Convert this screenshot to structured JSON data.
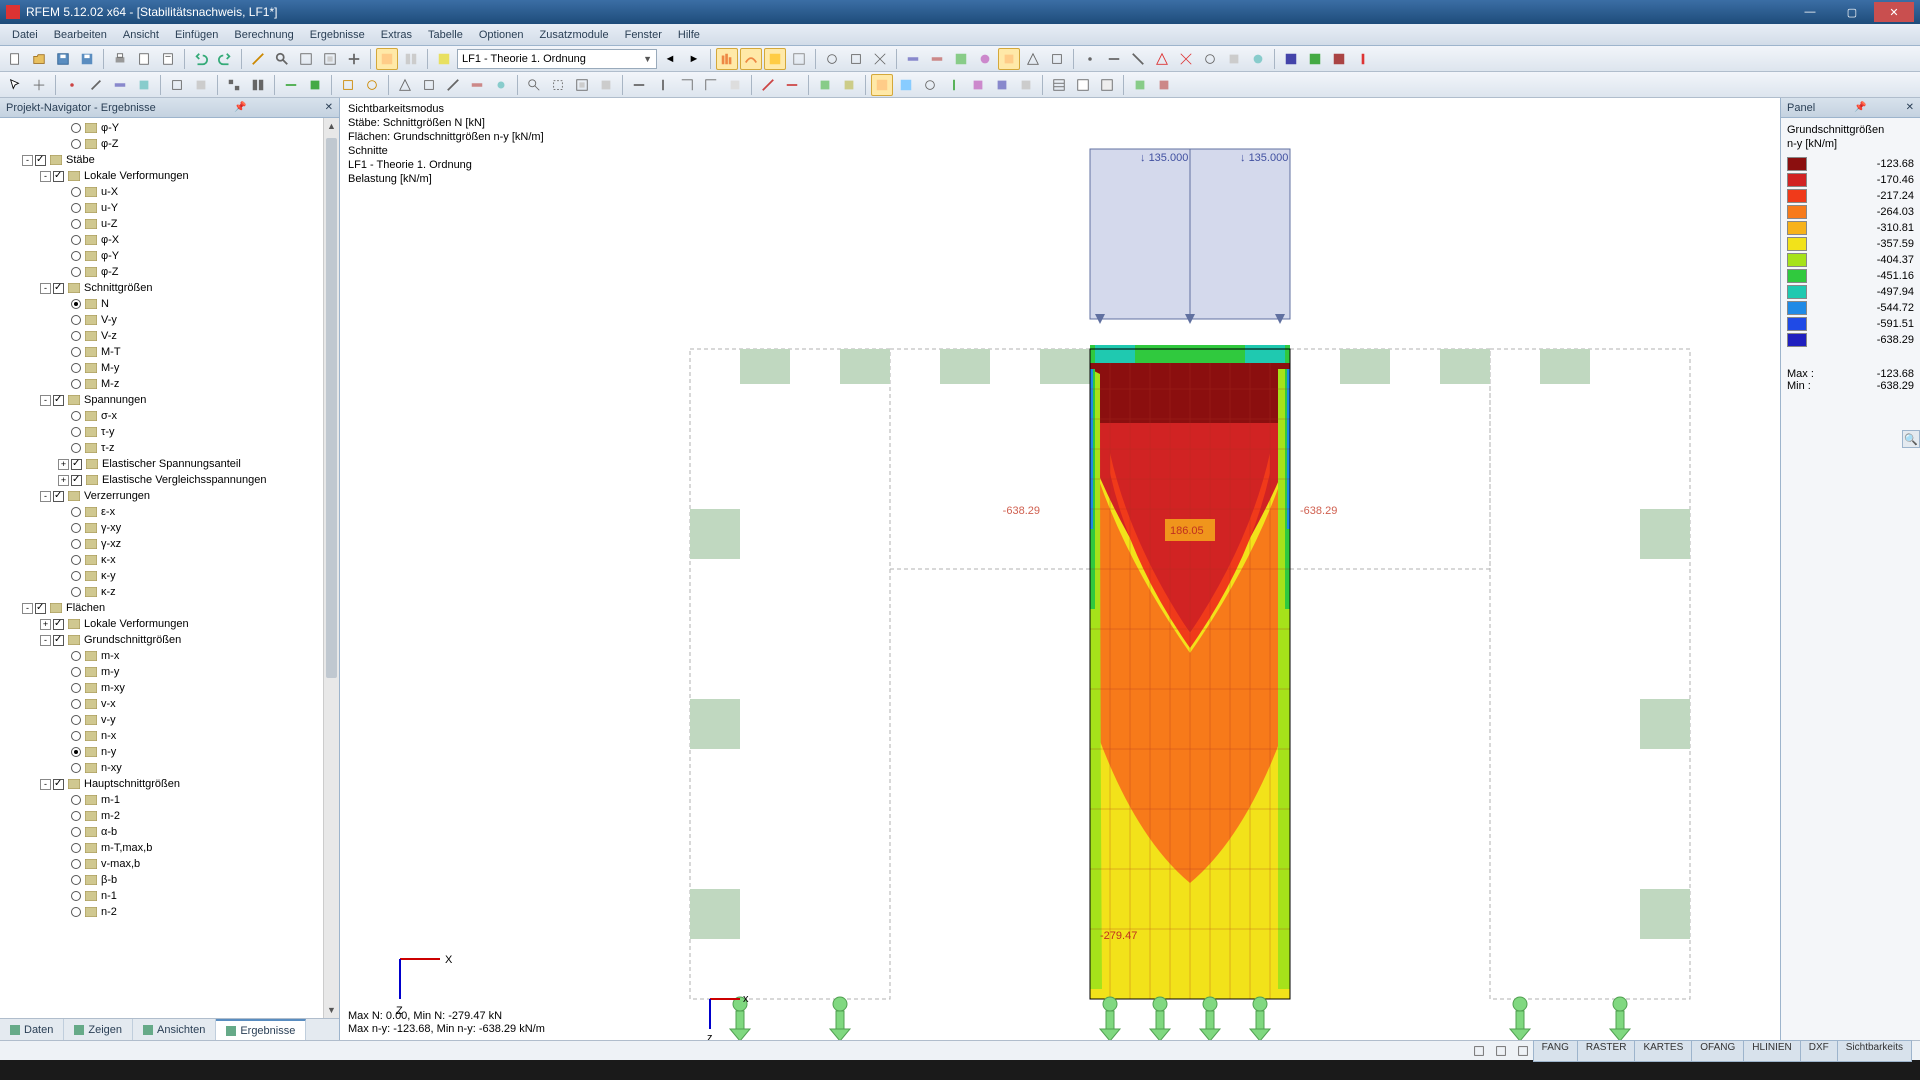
{
  "titlebar": {
    "text": "RFEM 5.12.02 x64 - [Stabilitätsnachweis, LF1*]"
  },
  "menu": [
    "Datei",
    "Bearbeiten",
    "Ansicht",
    "Einfügen",
    "Berechnung",
    "Ergebnisse",
    "Extras",
    "Tabelle",
    "Optionen",
    "Zusatzmodule",
    "Fenster",
    "Hilfe"
  ],
  "combo_lf": "LF1 - Theorie 1. Ordnung",
  "navigator": {
    "title": "Projekt-Navigator - Ergebnisse",
    "tabs": [
      "Daten",
      "Zeigen",
      "Ansichten",
      "Ergebnisse"
    ],
    "active_tab": 3,
    "tree": [
      {
        "d": 3,
        "type": "radio",
        "label": "φ-Y"
      },
      {
        "d": 3,
        "type": "radio",
        "label": "φ-Z"
      },
      {
        "d": 1,
        "type": "check",
        "checked": true,
        "label": "Stäbe",
        "exp": "-"
      },
      {
        "d": 2,
        "type": "check",
        "checked": true,
        "label": "Lokale Verformungen",
        "exp": "-"
      },
      {
        "d": 3,
        "type": "radio",
        "label": "u-X"
      },
      {
        "d": 3,
        "type": "radio",
        "label": "u-Y"
      },
      {
        "d": 3,
        "type": "radio",
        "label": "u-Z"
      },
      {
        "d": 3,
        "type": "radio",
        "label": "φ-X"
      },
      {
        "d": 3,
        "type": "radio",
        "label": "φ-Y"
      },
      {
        "d": 3,
        "type": "radio",
        "label": "φ-Z"
      },
      {
        "d": 2,
        "type": "check",
        "checked": true,
        "label": "Schnittgrößen",
        "exp": "-"
      },
      {
        "d": 3,
        "type": "radio",
        "sel": true,
        "label": "N"
      },
      {
        "d": 3,
        "type": "radio",
        "label": "V-y"
      },
      {
        "d": 3,
        "type": "radio",
        "label": "V-z"
      },
      {
        "d": 3,
        "type": "radio",
        "label": "M-T"
      },
      {
        "d": 3,
        "type": "radio",
        "label": "M-y"
      },
      {
        "d": 3,
        "type": "radio",
        "label": "M-z"
      },
      {
        "d": 2,
        "type": "check",
        "checked": true,
        "label": "Spannungen",
        "exp": "-"
      },
      {
        "d": 3,
        "type": "radio",
        "label": "σ-x"
      },
      {
        "d": 3,
        "type": "radio",
        "label": "τ-y"
      },
      {
        "d": 3,
        "type": "radio",
        "label": "τ-z"
      },
      {
        "d": 3,
        "type": "check",
        "checked": true,
        "label": "Elastischer Spannungsanteil",
        "exp": "+"
      },
      {
        "d": 3,
        "type": "check",
        "checked": true,
        "label": "Elastische Vergleichsspannungen",
        "exp": "+"
      },
      {
        "d": 2,
        "type": "check",
        "checked": true,
        "label": "Verzerrungen",
        "exp": "-"
      },
      {
        "d": 3,
        "type": "radio",
        "label": "ε-x"
      },
      {
        "d": 3,
        "type": "radio",
        "label": "γ-xy"
      },
      {
        "d": 3,
        "type": "radio",
        "label": "γ-xz"
      },
      {
        "d": 3,
        "type": "radio",
        "label": "κ-x"
      },
      {
        "d": 3,
        "type": "radio",
        "label": "κ-y"
      },
      {
        "d": 3,
        "type": "radio",
        "label": "κ-z"
      },
      {
        "d": 1,
        "type": "check",
        "checked": true,
        "label": "Flächen",
        "exp": "-"
      },
      {
        "d": 2,
        "type": "check",
        "checked": true,
        "label": "Lokale Verformungen",
        "exp": "+"
      },
      {
        "d": 2,
        "type": "check",
        "checked": true,
        "label": "Grundschnittgrößen",
        "exp": "-"
      },
      {
        "d": 3,
        "type": "radio",
        "label": "m-x"
      },
      {
        "d": 3,
        "type": "radio",
        "label": "m-y"
      },
      {
        "d": 3,
        "type": "radio",
        "label": "m-xy"
      },
      {
        "d": 3,
        "type": "radio",
        "label": "v-x"
      },
      {
        "d": 3,
        "type": "radio",
        "label": "v-y"
      },
      {
        "d": 3,
        "type": "radio",
        "label": "n-x"
      },
      {
        "d": 3,
        "type": "radio",
        "sel": true,
        "label": "n-y"
      },
      {
        "d": 3,
        "type": "radio",
        "label": "n-xy"
      },
      {
        "d": 2,
        "type": "check",
        "checked": true,
        "label": "Hauptschnittgrößen",
        "exp": "-"
      },
      {
        "d": 3,
        "type": "radio",
        "label": "m-1"
      },
      {
        "d": 3,
        "type": "radio",
        "label": "m-2"
      },
      {
        "d": 3,
        "type": "radio",
        "label": "α-b"
      },
      {
        "d": 3,
        "type": "radio",
        "label": "m-T,max,b"
      },
      {
        "d": 3,
        "type": "radio",
        "label": "v-max,b"
      },
      {
        "d": 3,
        "type": "radio",
        "label": "β-b"
      },
      {
        "d": 3,
        "type": "radio",
        "label": "n-1"
      },
      {
        "d": 3,
        "type": "radio",
        "label": "n-2"
      }
    ]
  },
  "viewport": {
    "overlay": [
      "Sichtbarkeitsmodus",
      "Stäbe: Schnittgrößen N [kN]",
      "Flächen: Grundschnittgrößen n-y [kN/m]",
      "Schnitte",
      "LF1 - Theorie 1. Ordnung",
      "Belastung [kN/m]"
    ],
    "labels": {
      "load_left": "135.000",
      "load_right": "135.000",
      "val_left": "638.29",
      "val_right": "638.29",
      "val_mid": "186.05",
      "val_bottom": "279.47"
    },
    "bottom_text": [
      "Max N: 0.00, Min N: -279.47 kN",
      "Max n-y: -123.68, Min n-y: -638.29 kN/m"
    ]
  },
  "panel": {
    "title": "Panel",
    "legend_title": "Grundschnittgrößen",
    "legend_unit": "n-y [kN/m]",
    "legend": [
      {
        "c": "#8b0f0f",
        "v": "-123.68"
      },
      {
        "c": "#d12323",
        "v": "-170.46"
      },
      {
        "c": "#f03a1a",
        "v": "-217.24"
      },
      {
        "c": "#f77a1a",
        "v": "-264.03"
      },
      {
        "c": "#f7b21a",
        "v": "-310.81"
      },
      {
        "c": "#f2e21a",
        "v": "-357.59"
      },
      {
        "c": "#a6e21a",
        "v": "-404.37"
      },
      {
        "c": "#30c93e",
        "v": "-451.16"
      },
      {
        "c": "#1fc9b0",
        "v": "-497.94"
      },
      {
        "c": "#1f8ae6",
        "v": "-544.72"
      },
      {
        "c": "#1f4ae6",
        "v": "-591.51"
      },
      {
        "c": "#1f1fbf",
        "v": "-638.29"
      }
    ],
    "max_label": "Max :",
    "max_val": "-123.68",
    "min_label": "Min  :",
    "min_val": "-638.29"
  },
  "statusbar": {
    "right_buttons": [
      "FANG",
      "RASTER",
      "KARTES",
      "OFANG",
      "HLINIEN",
      "DXF",
      "Sichtbarkeits"
    ]
  }
}
